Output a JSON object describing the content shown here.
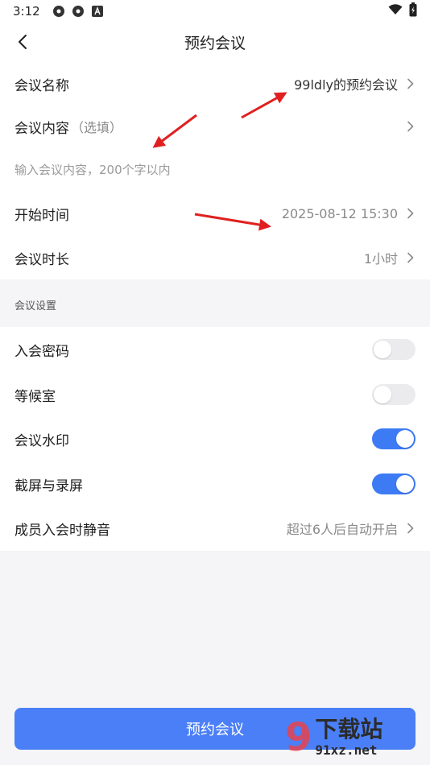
{
  "status_bar": {
    "time": "3:12",
    "icons": [
      "settings-gear-icon",
      "settings-gear-icon",
      "text-a-icon"
    ],
    "right_icons": [
      "wifi-icon",
      "battery-charging-icon"
    ]
  },
  "header": {
    "title": "预约会议",
    "back_icon": "chevron-left-icon"
  },
  "form": {
    "meeting_name": {
      "label": "会议名称",
      "value": "99ldly的预约会议"
    },
    "meeting_content": {
      "label": "会议内容",
      "hint": "（选填）",
      "placeholder": "输入会议内容，200个字以内"
    },
    "start_time": {
      "label": "开始时间",
      "value": "2025-08-12 15:30"
    },
    "duration": {
      "label": "会议时长",
      "value": "1小时"
    }
  },
  "settings": {
    "group_title": "会议设置",
    "password": {
      "label": "入会密码",
      "enabled": false
    },
    "waiting_room": {
      "label": "等候室",
      "enabled": false
    },
    "watermark": {
      "label": "会议水印",
      "enabled": true
    },
    "screenshot_recording": {
      "label": "截屏与录屏",
      "enabled": true
    },
    "mute_on_join": {
      "label": "成员入会时静音",
      "value": "超过6人后自动开启"
    }
  },
  "actions": {
    "submit_label": "预约会议"
  },
  "watermark_brand": {
    "logo_text": "9",
    "name": "下载站",
    "domain": "91xz.net"
  },
  "colors": {
    "accent": "#3d7bf5",
    "button": "#4a7ff7",
    "annotation_arrow": "#e02020",
    "background": "#f5f5f7"
  }
}
